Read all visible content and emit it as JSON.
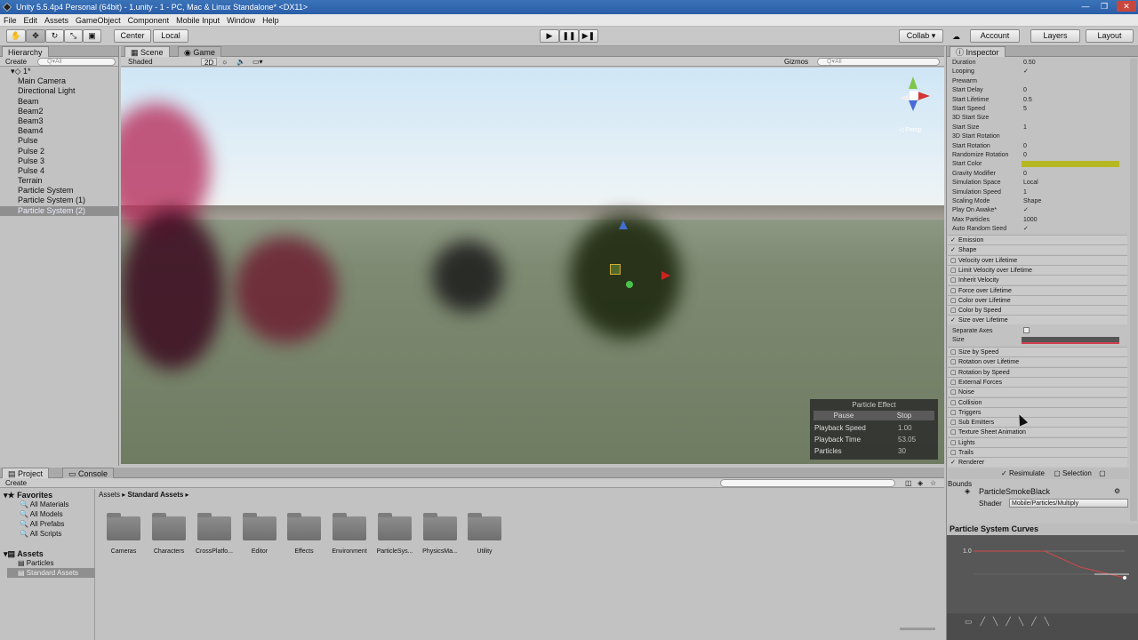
{
  "window": {
    "title": "Unity 5.5.4p4 Personal (64bit) - 1.unity - 1 - PC, Mac & Linux Standalone* <DX11>"
  },
  "menu": [
    "File",
    "Edit",
    "Assets",
    "GameObject",
    "Component",
    "Mobile Input",
    "Window",
    "Help"
  ],
  "toolbar": {
    "center": "Center",
    "local": "Local",
    "collab": "Collab ▾",
    "account": "Account",
    "layers": "Layers",
    "layout": "Layout"
  },
  "hierarchy": {
    "tab": "Hierarchy",
    "create": "Create",
    "search_placeholder": "Q▾All",
    "scene": "1*",
    "items": [
      "Main Camera",
      "Directional Light",
      "Beam",
      "Beam2",
      "Beam3",
      "Beam4",
      "Pulse",
      "Pulse 2",
      "Pulse 3",
      "Pulse 4",
      "Terrain",
      "Particle System",
      "Particle System (1)",
      "Particle System (2)"
    ]
  },
  "scene": {
    "tab_scene": "Scene",
    "tab_game": "Game",
    "shading": "Shaded",
    "mode2d": "2D",
    "gizmos": "Gizmos",
    "search_placeholder": "Q▾All",
    "persp": "◁ Persp"
  },
  "particle_effect": {
    "title": "Particle Effect",
    "pause": "Pause",
    "stop": "Stop",
    "rows": [
      {
        "label": "Playback Speed",
        "value": "1.00"
      },
      {
        "label": "Playback Time",
        "value": "53.05"
      },
      {
        "label": "Particles",
        "value": "30"
      }
    ]
  },
  "inspector": {
    "tab": "Inspector",
    "props": [
      {
        "label": "Duration",
        "value": "0.50"
      },
      {
        "label": "Looping",
        "value": "✓"
      },
      {
        "label": "Prewarm",
        "value": ""
      },
      {
        "label": "Start Delay",
        "value": "0"
      },
      {
        "label": "Start Lifetime",
        "value": "0.5"
      },
      {
        "label": "Start Speed",
        "value": "5"
      },
      {
        "label": "3D Start Size",
        "value": ""
      },
      {
        "label": "Start Size",
        "value": "1"
      },
      {
        "label": "3D Start Rotation",
        "value": ""
      },
      {
        "label": "Start Rotation",
        "value": "0"
      },
      {
        "label": "Randomize Rotation",
        "value": "0"
      },
      {
        "label": "Start Color",
        "value": ""
      },
      {
        "label": "Gravity Modifier",
        "value": "0"
      },
      {
        "label": "Simulation Space",
        "value": "Local"
      },
      {
        "label": "Simulation Speed",
        "value": "1"
      },
      {
        "label": "Scaling Mode",
        "value": "Shape"
      },
      {
        "label": "Play On Awake*",
        "value": "✓"
      },
      {
        "label": "Max Particles",
        "value": "1000"
      },
      {
        "label": "Auto Random Seed",
        "value": "✓"
      }
    ],
    "modules_a": [
      {
        "label": "Emission",
        "on": true
      },
      {
        "label": "Shape",
        "on": true
      },
      {
        "label": "Velocity over Lifetime",
        "on": false
      },
      {
        "label": "Limit Velocity over Lifetime",
        "on": false
      },
      {
        "label": "Inherit Velocity",
        "on": false
      },
      {
        "label": "Force over Lifetime",
        "on": false
      },
      {
        "label": "Color over Lifetime",
        "on": false
      },
      {
        "label": "Color by Speed",
        "on": false
      },
      {
        "label": "Size over Lifetime",
        "on": true
      }
    ],
    "separate_axes": "Separate Axes",
    "size": "Size",
    "modules_b": [
      {
        "label": "Size by Speed",
        "on": false
      },
      {
        "label": "Rotation over Lifetime",
        "on": false
      },
      {
        "label": "Rotation by Speed",
        "on": false
      },
      {
        "label": "External Forces",
        "on": false
      },
      {
        "label": "Noise",
        "on": false
      },
      {
        "label": "Collision",
        "on": false
      },
      {
        "label": "Triggers",
        "on": false
      },
      {
        "label": "Sub Emitters",
        "on": false
      },
      {
        "label": "Texture Sheet Animation",
        "on": false
      },
      {
        "label": "Lights",
        "on": false
      },
      {
        "label": "Trails",
        "on": false
      },
      {
        "label": "Renderer",
        "on": true
      }
    ],
    "resimulate": "Resimulate",
    "selection": "Selection",
    "bounds": "Bounds",
    "material": "ParticleSmokeBlack",
    "shader_label": "Shader",
    "shader": "Mobile/Particles/Multiply",
    "curves_title": "Particle System Curves",
    "curve_value": "1.0",
    "start_color": "#b7b722"
  },
  "project": {
    "tab": "Project",
    "console": "Console",
    "create": "Create",
    "breadcrumb_root": "Assets",
    "breadcrumb_current": "Standard Assets",
    "favorites": "Favorites",
    "fav_items": [
      "All Materials",
      "All Models",
      "All Prefabs",
      "All Scripts"
    ],
    "assets": "Assets",
    "asset_items": [
      "Particles",
      "Standard Assets"
    ],
    "folders": [
      "Cameras",
      "Characters",
      "CrossPlatfo...",
      "Editor",
      "Effects",
      "Environment",
      "ParticleSys...",
      "PhysicsMa...",
      "Utility"
    ]
  }
}
